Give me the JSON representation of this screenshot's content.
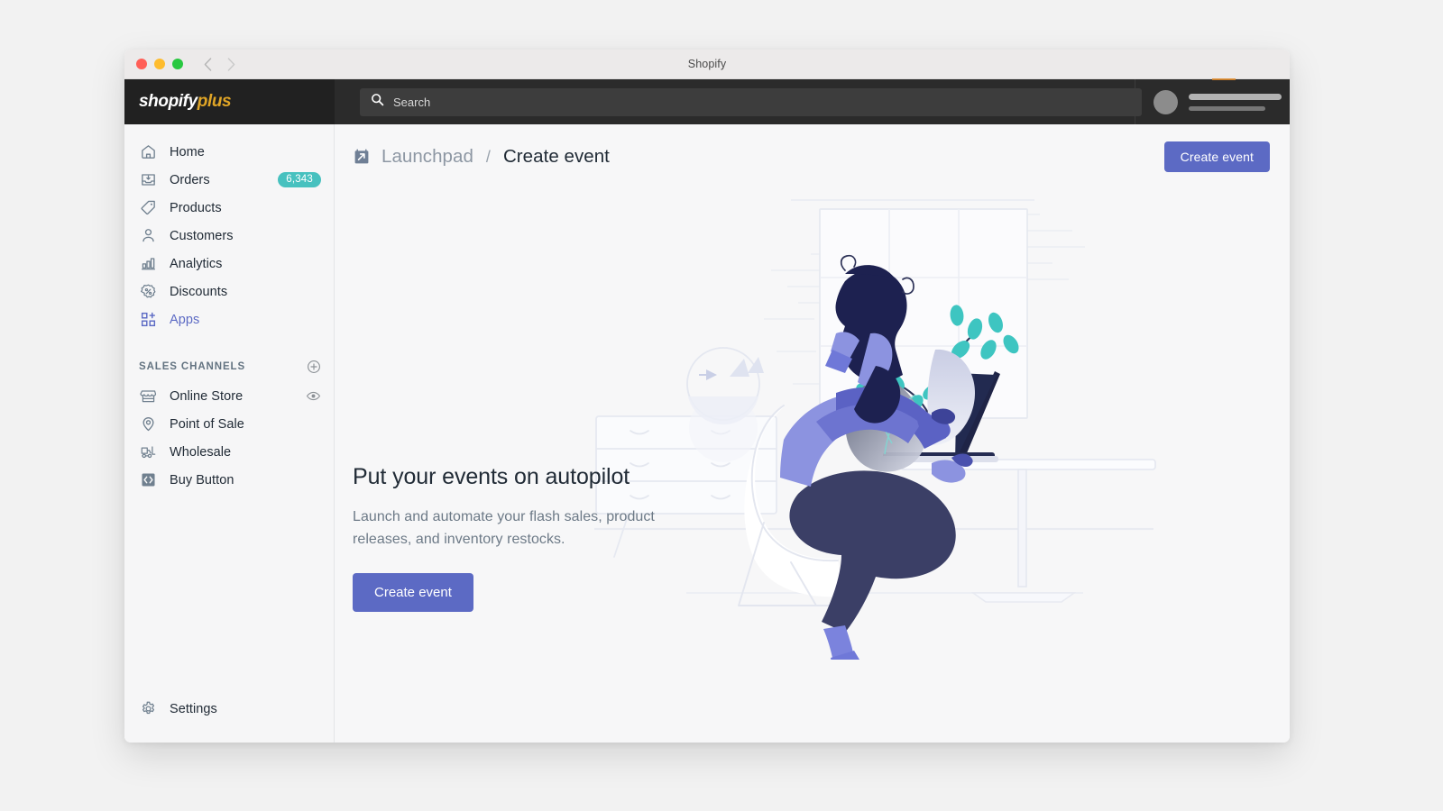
{
  "window": {
    "title": "Shopify",
    "traffic_lights": [
      "close",
      "minimize",
      "maximize"
    ],
    "back_label": "Back",
    "forward_label": "Forward"
  },
  "topbar": {
    "logo_primary": "shopify",
    "logo_secondary": "plus",
    "search": {
      "placeholder": "Search",
      "value": ""
    },
    "user": {
      "name_placeholder": "",
      "sub_placeholder": ""
    }
  },
  "sidebar": {
    "items": [
      {
        "label": "Home",
        "icon": "home-icon",
        "badge": null,
        "active": false
      },
      {
        "label": "Orders",
        "icon": "orders-icon",
        "badge": "6,343",
        "active": false
      },
      {
        "label": "Products",
        "icon": "products-tag-icon",
        "badge": null,
        "active": false
      },
      {
        "label": "Customers",
        "icon": "customers-person-icon",
        "badge": null,
        "active": false
      },
      {
        "label": "Analytics",
        "icon": "analytics-bars-icon",
        "badge": null,
        "active": false
      },
      {
        "label": "Discounts",
        "icon": "discounts-percent-icon",
        "badge": null,
        "active": false
      },
      {
        "label": "Apps",
        "icon": "apps-grid-plus-icon",
        "badge": null,
        "active": true
      }
    ],
    "section": {
      "title": "SALES CHANNELS",
      "add_icon": "plus-circle-icon",
      "channels": [
        {
          "label": "Online Store",
          "icon": "storefront-icon",
          "trailing_icon": "eye-icon"
        },
        {
          "label": "Point of Sale",
          "icon": "location-pin-icon",
          "trailing_icon": null
        },
        {
          "label": "Wholesale",
          "icon": "forklift-icon",
          "trailing_icon": null
        },
        {
          "label": "Buy Button",
          "icon": "code-brackets-icon",
          "trailing_icon": null
        }
      ]
    },
    "settings": {
      "label": "Settings",
      "icon": "gear-icon"
    }
  },
  "page": {
    "breadcrumb_icon": "launchpad-calendar-arrow-icon",
    "breadcrumb_parent": "Launchpad",
    "breadcrumb_separator": "/",
    "breadcrumb_current": "Create event",
    "header_action": "Create event"
  },
  "empty_state": {
    "heading": "Put your events on autopilot",
    "description": "Launch and automate your flash sales, product releases, and inventory restocks.",
    "cta": "Create event",
    "illustration": "person-sitting-at-desk-with-laptop-illustration"
  },
  "colors": {
    "accent_indigo": "#5c6ac4",
    "badge_teal": "#47c1bf",
    "topbar_dark": "#2b2b2b",
    "brand_dark": "#212121",
    "logo_gold": "#e0a526",
    "sidebar_bg": "#f6f6f7",
    "content_bg": "#f7f7f8",
    "text_primary": "#212b36",
    "text_muted": "#6d7a87",
    "illustration_teal": "#3ec5c1",
    "illustration_navy": "#1d2150",
    "illustration_periwinkle": "#8c93e0"
  }
}
